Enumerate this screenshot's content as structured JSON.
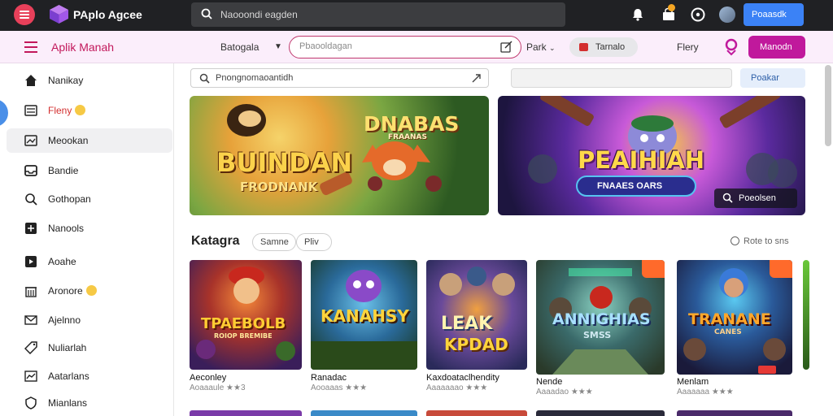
{
  "topbar": {
    "app_title": "PAplo Agcee",
    "search_placeholder": "Naooondi eagden",
    "primary_button": "Poaasdk",
    "icons": [
      "menu-icon",
      "cube-logo-icon",
      "search-icon",
      "notification-icon",
      "cart-icon",
      "info-icon",
      "avatar"
    ]
  },
  "subbar": {
    "title": "Aplik Manah",
    "category": "Batogala",
    "search_placeholder": "Pbaooldagan",
    "park_label": "Park",
    "pill_label": "Tarnalo",
    "flery_label": "Flery",
    "action_button": "Manodn"
  },
  "sidebar": {
    "items": [
      {
        "label": "Nanikay",
        "icon": "home-icon"
      },
      {
        "label": "Fleny",
        "icon": "list-icon",
        "emoji": true,
        "red": true
      },
      {
        "label": "Meookan",
        "icon": "image-icon",
        "active": true
      },
      {
        "label": "Bandie",
        "icon": "inbox-icon"
      },
      {
        "label": "Gothopan",
        "icon": "search-icon"
      },
      {
        "label": "Nanools",
        "icon": "plus-square-icon"
      },
      {
        "label": "Aoahe",
        "icon": "play-square-icon"
      },
      {
        "label": "Aronore",
        "icon": "building-icon",
        "emoji": true
      },
      {
        "label": "Ajelnno",
        "icon": "mail-icon"
      },
      {
        "label": "Nuliarlah",
        "icon": "tag-icon"
      },
      {
        "label": "Aatarlans",
        "icon": "chart-icon"
      },
      {
        "label": "Mianlans",
        "icon": "shield-icon"
      }
    ]
  },
  "main": {
    "search_placeholder": "Pnongnomaoantidh",
    "blue_button": "Poakar",
    "banner1": {
      "title": "BUINDAN",
      "subtitle": "FRODNANK",
      "top_title": "DNABAS",
      "top_subtitle": "FRAANAS"
    },
    "banner2": {
      "title": "PEAIHIAH",
      "pill": "FNAAES OARS",
      "chip": "Poeolsen"
    },
    "section_title": "Katagra",
    "chips": [
      "Samne",
      "Pliv"
    ],
    "see_all": "Rote to sns",
    "cards": [
      {
        "name": "Aeconley",
        "meta": "Aoaaaule ★★3",
        "art_line1": "TPAEBOLB",
        "art_line2": "ROIOP BREMIBE"
      },
      {
        "name": "Ranadac",
        "meta": "Aooaaas ★★★",
        "art_line1": "KANAHSY",
        "art_line2": ""
      },
      {
        "name": "Kaxdoataclhendity",
        "meta": "Aaaaaaao ★★★",
        "art_line1": "LEAK",
        "art_line2": "KPDAD"
      },
      {
        "name": "Nende",
        "meta": "Aaaadao ★★★",
        "art_line1": "ANNIGHIAS",
        "art_line2": "SMSS"
      },
      {
        "name": "Menlam",
        "meta": "Aaaaaaa ★★★",
        "art_line1": "TRANANE",
        "art_line2": "CANES"
      }
    ]
  },
  "colors": {
    "topbar_bg": "#202124",
    "subbar_bg": "#fbeefb",
    "accent_magenta": "#c0199c",
    "accent_red": "#c2185b",
    "primary_blue": "#3b82f6"
  }
}
